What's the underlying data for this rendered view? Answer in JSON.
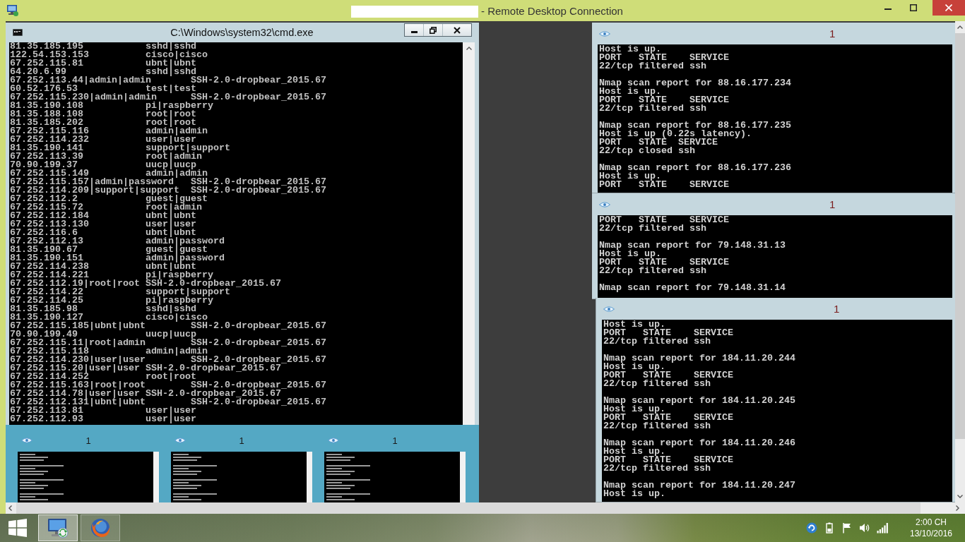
{
  "window": {
    "title": "- Remote Desktop Connection"
  },
  "cmd_window": {
    "title": "C:\\Windows\\system32\\cmd.exe",
    "lines": [
      "81.35.185.195           sshd|sshd",
      "122.54.153.153          cisco|cisco",
      "67.252.115.81           ubnt|ubnt",
      "64.20.6.99              sshd|sshd",
      "67.252.113.44|admin|admin       SSH-2.0-dropbear_2015.67",
      "60.52.176.53            test|test",
      "67.252.115.230|admin|admin      SSH-2.0-dropbear_2015.67",
      "81.35.190.108           pi|raspberry",
      "81.35.188.108           root|root",
      "81.35.185.202           root|root",
      "67.252.115.116          admin|admin",
      "67.252.114.232          user|user",
      "81.35.190.141           support|support",
      "67.252.113.39           root|admin",
      "70.90.199.37            uucp|uucp",
      "67.252.115.149          admin|admin",
      "67.252.115.157|admin|password   SSH-2.0-dropbear_2015.67",
      "67.252.114.209|support|support  SSH-2.0-dropbear_2015.67",
      "67.252.112.2            guest|guest",
      "67.252.115.72           root|admin",
      "67.252.112.184          ubnt|ubnt",
      "67.252.113.130          user|user",
      "67.252.116.6            ubnt|ubnt",
      "67.252.112.13           admin|password",
      "81.35.190.67            guest|guest",
      "81.35.190.151           admin|password",
      "67.252.114.238          ubnt|ubnt",
      "67.252.114.221          pi|raspberry",
      "67.252.112.19|root|root SSH-2.0-dropbear_2015.67",
      "67.252.114.22           support|support",
      "67.252.114.25           pi|raspberry",
      "81.35.185.98            sshd|sshd",
      "81.35.190.127           cisco|cisco",
      "67.252.115.185|ubnt|ubnt        SSH-2.0-dropbear_2015.67",
      "70.90.199.49            uucp|uucp",
      "67.252.115.11|root|admin        SSH-2.0-dropbear_2015.67",
      "67.252.115.118          admin|admin",
      "67.252.114.230|user|user        SSH-2.0-dropbear_2015.67",
      "67.252.115.20|user|user SSH-2.0-dropbear_2015.67",
      "67.252.114.252          root|root",
      "67.252.115.163|root|root        SSH-2.0-dropbear_2015.67",
      "67.252.114.78|user|user SSH-2.0-dropbear_2015.67",
      "67.252.112.131|ubnt|ubnt        SSH-2.0-dropbear_2015.67",
      "67.252.113.81           user|user",
      "67.252.112.93           user|user"
    ]
  },
  "thumbnails": [
    {
      "title": "1"
    },
    {
      "title": "1"
    },
    {
      "title": "1"
    }
  ],
  "terminals": [
    {
      "title": "1",
      "blocks": [
        {
          "lines": [
            "Host is up.",
            "PORT   STATE    SERVICE",
            "22/tcp filtered ssh"
          ]
        },
        {
          "lines": [
            "Nmap scan report for 88.16.177.234",
            "Host is up.",
            "PORT   STATE    SERVICE",
            "22/tcp filtered ssh"
          ]
        },
        {
          "lines": [
            "Nmap scan report for 88.16.177.235",
            "Host is up (0.22s latency).",
            "PORT   STATE  SERVICE",
            "22/tcp closed ssh"
          ]
        },
        {
          "lines": [
            "Nmap scan report for 88.16.177.236",
            "Host is up.",
            "PORT   STATE    SERVICE"
          ]
        }
      ]
    },
    {
      "title": "1",
      "blocks": [
        {
          "lines": [
            "PORT   STATE    SERVICE",
            "22/tcp filtered ssh"
          ]
        },
        {
          "lines": [
            "Nmap scan report for 79.148.31.13",
            "Host is up.",
            "PORT   STATE    SERVICE",
            "22/tcp filtered ssh"
          ]
        },
        {
          "lines": [
            "Nmap scan report for 79.148.31.14"
          ]
        }
      ]
    },
    {
      "title": "1",
      "blocks": [
        {
          "lines": [
            "Host is up.",
            "PORT   STATE    SERVICE",
            "22/tcp filtered ssh"
          ]
        },
        {
          "lines": [
            "Nmap scan report for 184.11.20.244",
            "Host is up.",
            "PORT   STATE    SERVICE",
            "22/tcp filtered ssh"
          ]
        },
        {
          "lines": [
            "Nmap scan report for 184.11.20.245",
            "Host is up.",
            "PORT   STATE    SERVICE",
            "22/tcp filtered ssh"
          ]
        },
        {
          "lines": [
            "Nmap scan report for 184.11.20.246",
            "Host is up.",
            "PORT   STATE    SERVICE",
            "22/tcp filtered ssh"
          ]
        },
        {
          "lines": [
            "Nmap scan report for 184.11.20.247",
            "Host is up."
          ]
        }
      ]
    }
  ],
  "taskbar": {
    "apps": [
      {
        "kind": "rdp",
        "selected": true
      },
      {
        "kind": "firefox",
        "selected": false
      }
    ],
    "clock": {
      "time": "2:00 CH",
      "date": "13/10/2016"
    }
  }
}
